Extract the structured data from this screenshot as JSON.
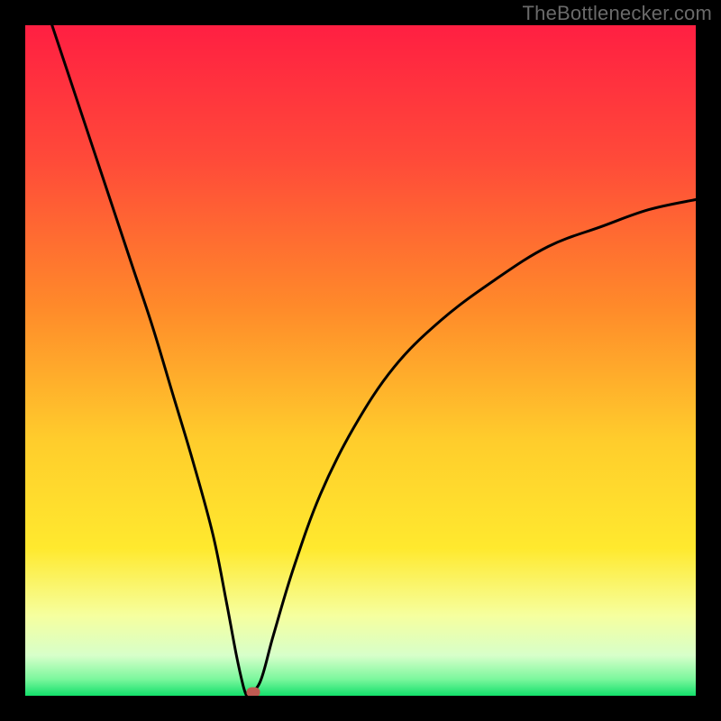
{
  "watermark": {
    "text": "TheBottlenecker.com"
  },
  "colors": {
    "top": "#ff1f42",
    "mid_orange": "#ff8a2a",
    "yellow": "#ffe92e",
    "pale": "#f6ff9e",
    "green": "#13e06b",
    "curve": "#000000",
    "marker": "#c05a52",
    "frame": "#000000"
  },
  "chart_data": {
    "type": "line",
    "title": "",
    "xlabel": "",
    "ylabel": "",
    "xlim": [
      0,
      100
    ],
    "ylim": [
      0,
      100
    ],
    "grid": false,
    "curve": {
      "minimum_x": 33,
      "minimum_y": 0,
      "left_branch": [
        {
          "x": 4,
          "y": 100
        },
        {
          "x": 7,
          "y": 91
        },
        {
          "x": 10,
          "y": 82
        },
        {
          "x": 13,
          "y": 73
        },
        {
          "x": 16,
          "y": 64
        },
        {
          "x": 19,
          "y": 55
        },
        {
          "x": 22,
          "y": 45
        },
        {
          "x": 25,
          "y": 35
        },
        {
          "x": 28,
          "y": 24
        },
        {
          "x": 30,
          "y": 14
        },
        {
          "x": 31.5,
          "y": 6
        },
        {
          "x": 32.5,
          "y": 1.5
        },
        {
          "x": 33,
          "y": 0
        }
      ],
      "right_branch": [
        {
          "x": 33,
          "y": 0
        },
        {
          "x": 35,
          "y": 2
        },
        {
          "x": 37,
          "y": 9
        },
        {
          "x": 40,
          "y": 19
        },
        {
          "x": 44,
          "y": 30
        },
        {
          "x": 49,
          "y": 40
        },
        {
          "x": 55,
          "y": 49
        },
        {
          "x": 62,
          "y": 56
        },
        {
          "x": 70,
          "y": 62
        },
        {
          "x": 78,
          "y": 67
        },
        {
          "x": 86,
          "y": 70
        },
        {
          "x": 93,
          "y": 72.5
        },
        {
          "x": 100,
          "y": 74
        }
      ]
    },
    "marker": {
      "x": 34,
      "y": 0.5
    },
    "gradient_stops": [
      {
        "offset": 0.0,
        "color": "#ff1f42"
      },
      {
        "offset": 0.2,
        "color": "#ff4a39"
      },
      {
        "offset": 0.42,
        "color": "#ff8a2a"
      },
      {
        "offset": 0.62,
        "color": "#ffcd2c"
      },
      {
        "offset": 0.78,
        "color": "#ffe92e"
      },
      {
        "offset": 0.88,
        "color": "#f6ff9e"
      },
      {
        "offset": 0.94,
        "color": "#d7ffca"
      },
      {
        "offset": 0.975,
        "color": "#7cf79d"
      },
      {
        "offset": 1.0,
        "color": "#13e06b"
      }
    ]
  }
}
